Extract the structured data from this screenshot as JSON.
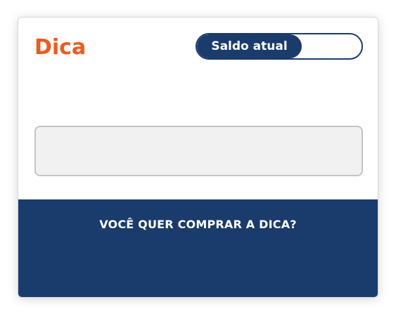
{
  "card": {
    "title": "Dica",
    "balance_toggle": {
      "label": "Saldo atual",
      "value": ""
    },
    "hint_text": "",
    "footer": {
      "question": "VOCÊ QUER COMPRAR A DICA?"
    }
  },
  "colors": {
    "title": "#f05a1a",
    "primary": "#1a3c6c",
    "hint_bg": "#f1f1f1",
    "hint_border": "#c4c4c4"
  }
}
